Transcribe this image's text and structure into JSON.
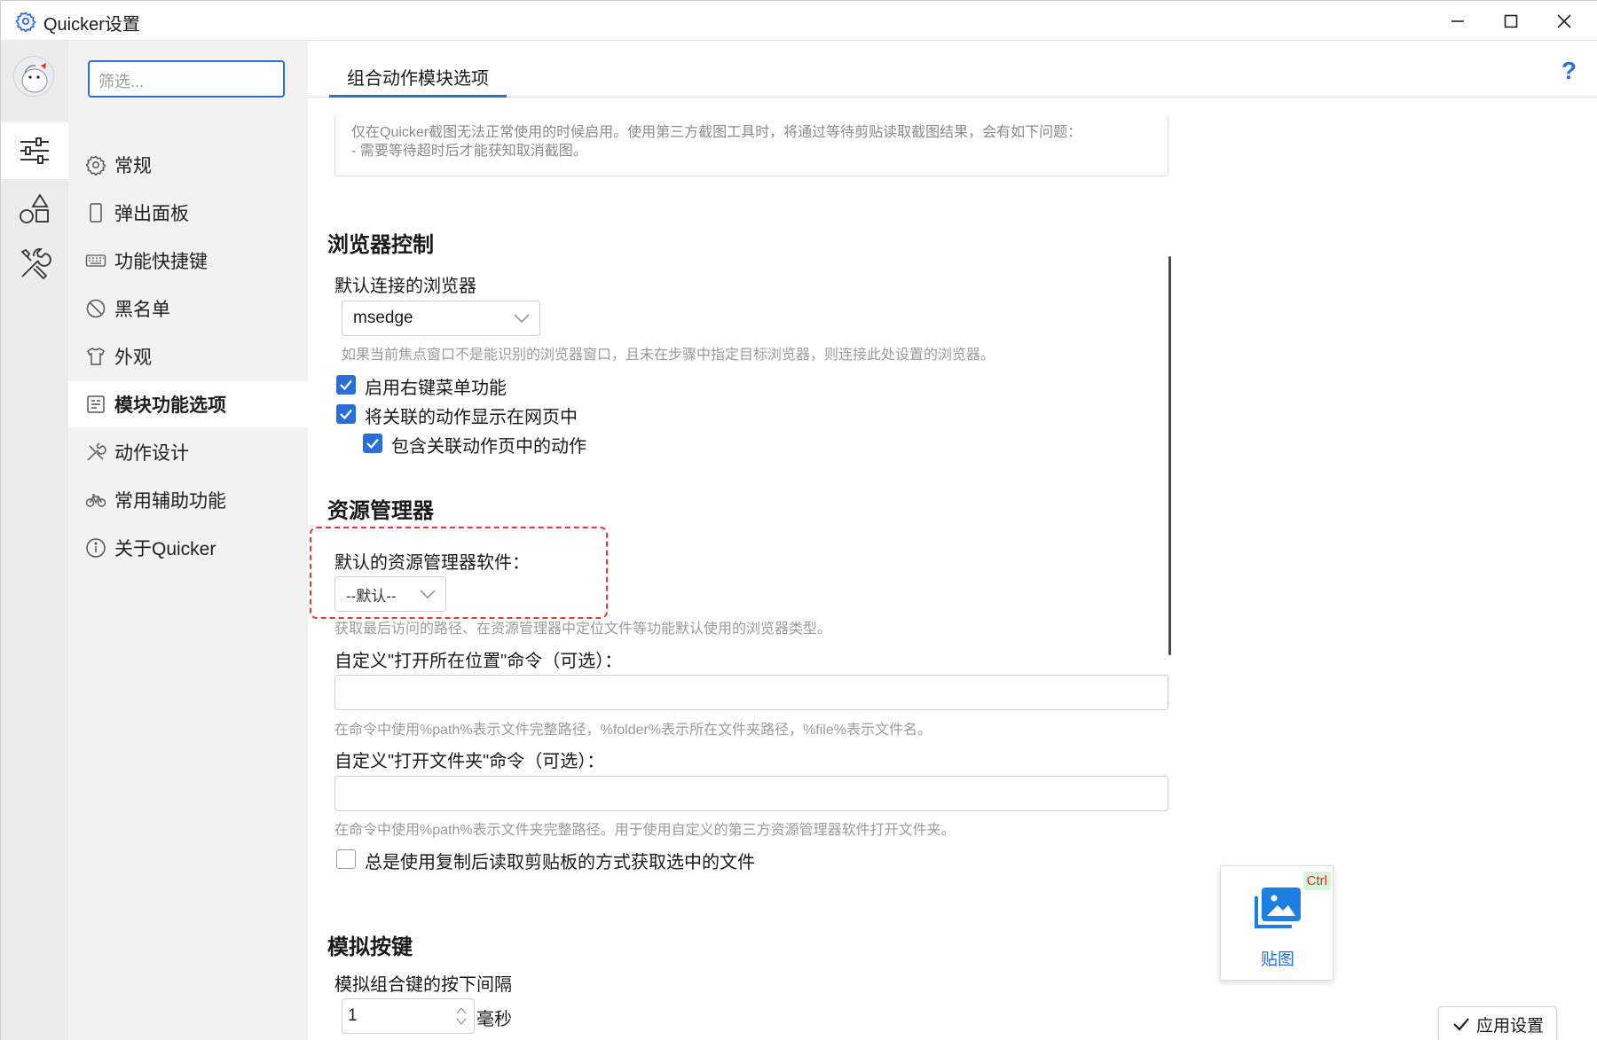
{
  "window": {
    "title": "Quicker设置",
    "accent": "#2b6fd6"
  },
  "rail": {
    "items": [
      {
        "icon": "sliders-icon",
        "active": true
      },
      {
        "icon": "shapes-icon",
        "active": false
      },
      {
        "icon": "tools-icon",
        "active": false
      }
    ]
  },
  "nav": {
    "filter_placeholder": "筛选...",
    "items": [
      {
        "label": "常规",
        "icon": "gear-icon"
      },
      {
        "label": "弹出面板",
        "icon": "panel-icon"
      },
      {
        "label": "功能快捷键",
        "icon": "keyboard-icon"
      },
      {
        "label": "黑名单",
        "icon": "blocked-icon"
      },
      {
        "label": "外观",
        "icon": "shirt-icon"
      },
      {
        "label": "模块功能选项",
        "icon": "module-icon",
        "active": true
      },
      {
        "label": "动作设计",
        "icon": "design-icon"
      },
      {
        "label": "常用辅助功能",
        "icon": "bike-icon"
      },
      {
        "label": "关于Quicker",
        "icon": "info-icon"
      }
    ]
  },
  "tabs": [
    {
      "label": "组合动作模块选项",
      "active": true
    }
  ],
  "help_label": "?",
  "screenshot_desc": {
    "line1": "仅在Quicker截图无法正常使用的时候启用。使用第三方截图工具时，将通过等待剪贴读取截图结果，会有如下问题：",
    "line2": "- 需要等待超时后才能获知取消截图。"
  },
  "browser_section": {
    "title": "浏览器控制",
    "default_browser_label": "默认连接的浏览器",
    "default_browser_value": "msedge",
    "default_browser_hint": "如果当前焦点窗口不是能识别的浏览器窗口，且未在步骤中指定目标浏览器，则连接此处设置的浏览器。",
    "checkboxes": [
      {
        "label": "启用右键菜单功能",
        "checked": true
      },
      {
        "label": "将关联的动作显示在网页中",
        "checked": true
      },
      {
        "label": "包含关联动作页中的动作",
        "checked": true
      }
    ]
  },
  "explorer_section": {
    "title": "资源管理器",
    "default_label": "默认的资源管理器软件：",
    "default_value": "--默认--",
    "default_hint": "获取最后访问的路径、在资源管理器中定位文件等功能默认使用的浏览器类型。",
    "open_location_label": "自定义\"打开所在位置\"命令（可选）：",
    "open_location_value": "",
    "open_location_hint": "在命令中使用%path%表示文件完整路径，%folder%表示所在文件夹路径，%file%表示文件名。",
    "open_folder_label": "自定义\"打开文件夹\"命令（可选）：",
    "open_folder_value": "",
    "open_folder_hint": "在命令中使用%path%表示文件夹完整路径。用于使用自定义的第三方资源管理器软件打开文件夹。",
    "copy_checkbox": {
      "label": "总是使用复制后读取剪贴板的方式获取选中的文件",
      "checked": false
    }
  },
  "keys_section": {
    "title": "模拟按键",
    "interval_label": "模拟组合键的按下间隔",
    "interval_value": "1",
    "interval_unit": "毫秒"
  },
  "floating_tile": {
    "badge": "Ctrl",
    "label": "贴图",
    "icon": "image-folder-icon"
  },
  "apply_button": "应用设置"
}
